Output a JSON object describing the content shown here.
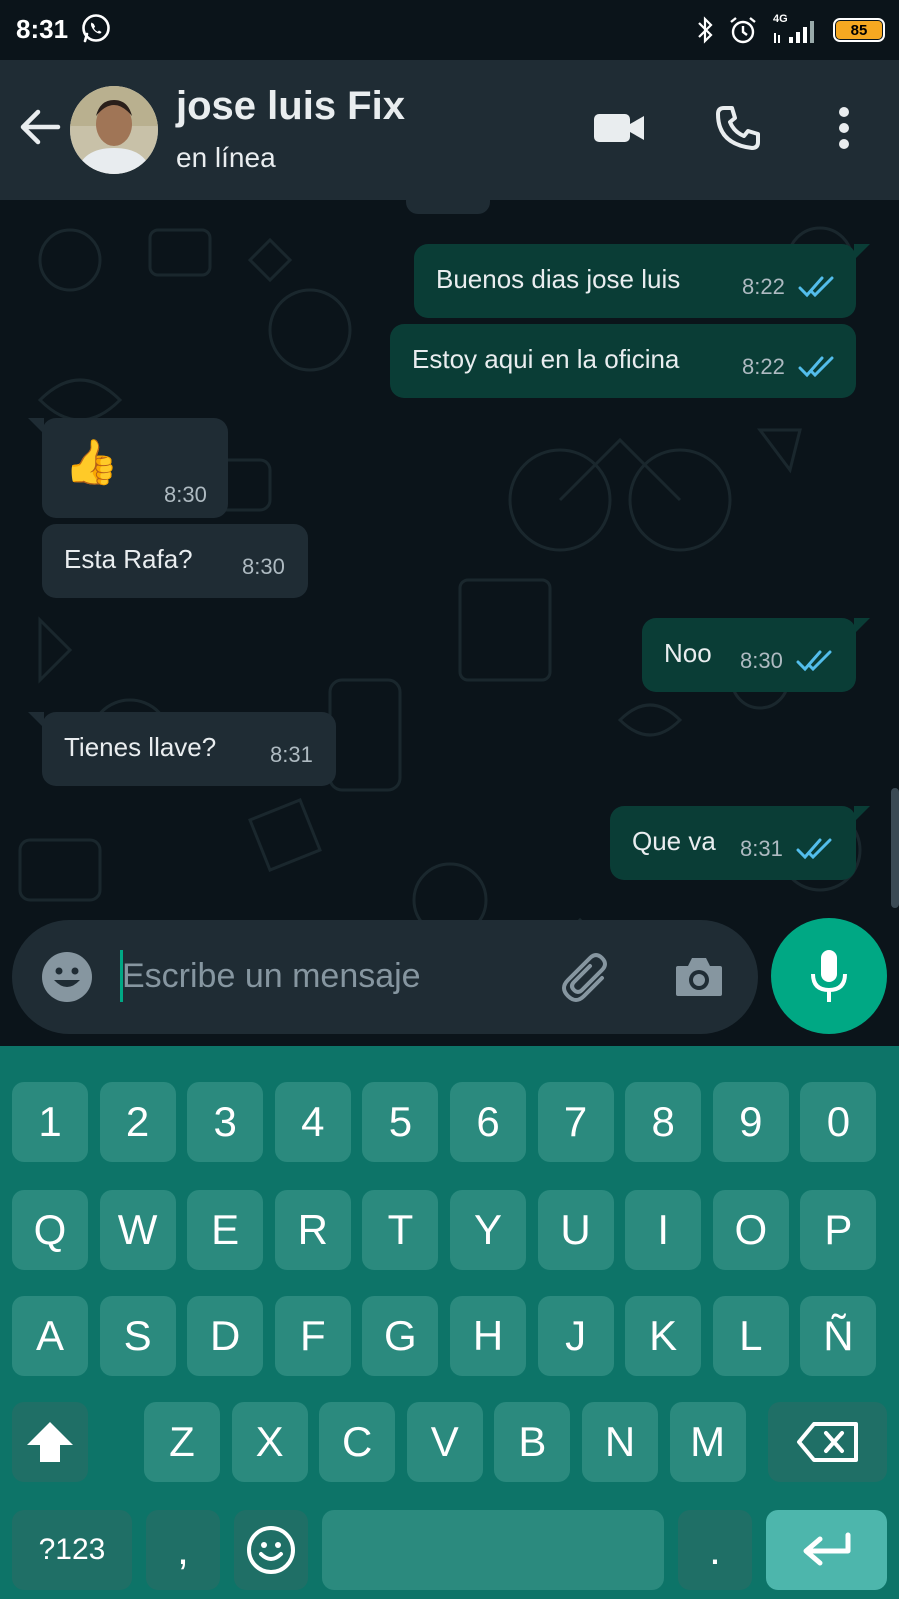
{
  "status_bar": {
    "time": "8:31",
    "network": "4G",
    "battery": "85",
    "icons": [
      "whatsapp-icon",
      "bluetooth-icon",
      "alarm-icon",
      "signal-icon",
      "battery-icon"
    ]
  },
  "header": {
    "contact_name": "jose luis Fix",
    "contact_status": "en línea",
    "icons": [
      "back-arrow-icon",
      "video-call-icon",
      "phone-call-icon",
      "more-options-icon"
    ]
  },
  "messages": [
    {
      "direction": "out",
      "text": "Buenos dias jose luis",
      "time": "8:22",
      "read": true
    },
    {
      "direction": "out",
      "text": "Estoy aqui en la oficina",
      "time": "8:22",
      "read": true
    },
    {
      "direction": "in",
      "text": "👍",
      "time": "8:30"
    },
    {
      "direction": "in",
      "text": "Esta Rafa?",
      "time": "8:30"
    },
    {
      "direction": "out",
      "text": "Noo",
      "time": "8:30",
      "read": true
    },
    {
      "direction": "in",
      "text": "Tienes llave?",
      "time": "8:31"
    },
    {
      "direction": "out",
      "text": "Que va",
      "time": "8:31",
      "read": true
    }
  ],
  "composer": {
    "placeholder": "Escribe un mensaje",
    "value": ""
  },
  "keyboard": {
    "row_numbers": [
      "1",
      "2",
      "3",
      "4",
      "5",
      "6",
      "7",
      "8",
      "9",
      "0"
    ],
    "row1": [
      "Q",
      "W",
      "E",
      "R",
      "T",
      "Y",
      "U",
      "I",
      "O",
      "P"
    ],
    "row2": [
      "A",
      "S",
      "D",
      "F",
      "G",
      "H",
      "J",
      "K",
      "L",
      "Ñ"
    ],
    "row3": [
      "Z",
      "X",
      "C",
      "V",
      "B",
      "N",
      "M"
    ],
    "symbols_key": "?123",
    "comma_key": ",",
    "period_key": "."
  },
  "colors": {
    "background": "#0b141a",
    "header": "#1f2c34",
    "outgoing_bubble": "#0a3d36",
    "incoming_bubble": "#1f2c34",
    "accent": "#00a884",
    "read_ticks": "#53bdeb",
    "keyboard": "#0d7468"
  }
}
